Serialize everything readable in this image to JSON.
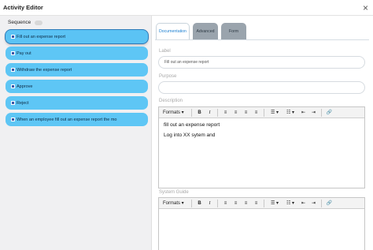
{
  "window": {
    "title": "Activity Editor",
    "close_glyph": "×"
  },
  "sequence": {
    "label": "Sequence"
  },
  "steps": [
    {
      "label": "Fill out an expense report",
      "icon": "step-icon",
      "active": true
    },
    {
      "label": "Pay out",
      "icon": "step-icon"
    },
    {
      "label": "Withdraw the expense report",
      "icon": "step-icon"
    },
    {
      "label": "Approve",
      "icon": "step-icon"
    },
    {
      "label": "Reject",
      "icon": "step-icon"
    },
    {
      "label": "When an employee fill out an expense report the mo",
      "icon": "step-icon"
    }
  ],
  "tabs": [
    {
      "label": "Documentation",
      "active": true
    },
    {
      "label": "Advanced"
    },
    {
      "label": "Form"
    }
  ],
  "fields": {
    "label": {
      "caption": "Label",
      "value": "Fill out an expense report"
    },
    "purpose": {
      "caption": "Purpose",
      "value": ""
    },
    "description": {
      "caption": "Description",
      "lines": [
        "fill out an expense report",
        "Log into XX sytem and"
      ]
    },
    "system_guide": {
      "caption": "System Guide"
    }
  },
  "toolbar": {
    "formats": "Formats ▾",
    "bold": "B",
    "italic": "I",
    "align_left": "≡",
    "align_center": "≡",
    "align_right": "≡",
    "justify": "≡",
    "bullet_list": "☰ ▾",
    "numbered_list": "☷ ▾",
    "outdent": "⇤",
    "indent": "⇥",
    "link": "🔗"
  },
  "colors": {
    "step": "#5ec6f5",
    "active_tab_text": "#1b7fd1",
    "inactive_tab": "#9aa4ad",
    "step_icon": "#3a56a8"
  }
}
